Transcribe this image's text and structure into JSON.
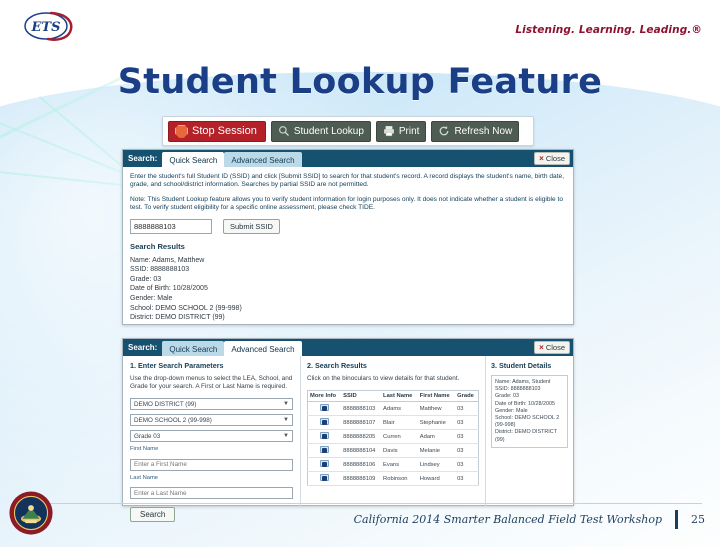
{
  "header": {
    "logo_text": "ETS",
    "tagline": "Listening. Learning. Leading.®"
  },
  "slide": {
    "title": "Student Lookup Feature"
  },
  "toolbar": {
    "stop_session": "Stop Session",
    "student_lookup": "Student Lookup",
    "print": "Print",
    "refresh_now": "Refresh Now"
  },
  "quick_panel": {
    "search_label": "Search:",
    "tab_quick": "Quick Search",
    "tab_advanced": "Advanced Search",
    "close_label": "Close",
    "close_x": "×",
    "help_paragraph": "Enter the student's full Student ID (SSID) and click [Submit SSID] to search for that student's record. A record displays the student's name, birth date, grade, and school/district information. Searches by partial SSID are not permitted.",
    "note_paragraph": "Note: This Student Lookup feature allows you to verify student information for login purposes only. It does not indicate whether a student is eligible to test. To verify student eligibility for a specific online assessment, please check TIDE.",
    "ssid_value": "8888888103",
    "submit_label": "Submit SSID",
    "results_heading": "Search Results",
    "result_lines": [
      "Name: Adams, Matthew",
      "SSID: 8888888103",
      "Grade: 03",
      "Date of Birth: 10/28/2005",
      "Gender: Male",
      "School: DEMO SCHOOL 2 (99-998)",
      "District: DEMO DISTRICT (99)"
    ]
  },
  "advanced_panel": {
    "search_label": "Search:",
    "tab_quick": "Quick Search",
    "tab_advanced": "Advanced Search",
    "close_label": "Close",
    "close_x": "×",
    "params": {
      "title": "1. Enter Search Parameters",
      "description": "Use the drop-down menus to select the LEA, School, and Grade for your search. A First or Last Name is required.",
      "district_value": "DEMO DISTRICT (99)",
      "school_value": "DEMO SCHOOL 2 (99-998)",
      "grade_value": "Grade 03",
      "first_name_label": "First Name",
      "first_name_placeholder": "Enter a First Name",
      "last_name_label": "Last Name",
      "last_name_placeholder": "Enter a Last Name",
      "search_button": "Search",
      "caret": "▼"
    },
    "results": {
      "title": "2. Search Results",
      "description": "Click on the binoculars to view details for that student.",
      "columns": [
        "More Info",
        "SSID",
        "Last Name",
        "First Name",
        "Grade"
      ],
      "rows": [
        {
          "ssid": "8888888103",
          "last_name": "Adams",
          "first_name": "Matthew",
          "grade": "03"
        },
        {
          "ssid": "8888888107",
          "last_name": "Blair",
          "first_name": "Stephanie",
          "grade": "03"
        },
        {
          "ssid": "8888888205",
          "last_name": "Curren",
          "first_name": "Adam",
          "grade": "03"
        },
        {
          "ssid": "8888888104",
          "last_name": "Davis",
          "first_name": "Melanie",
          "grade": "03"
        },
        {
          "ssid": "8888888106",
          "last_name": "Evans",
          "first_name": "Lindsey",
          "grade": "03"
        },
        {
          "ssid": "8888888109",
          "last_name": "Robinson",
          "first_name": "Howard",
          "grade": "03"
        }
      ]
    },
    "details": {
      "title": "3. Student Details",
      "lines": [
        "Name: Adams, Student",
        "SSID: 8888888103",
        "Grade: 03",
        "Date of Birth: 10/28/2005",
        "Gender: Male",
        "School: DEMO SCHOOL 2 (99-998)",
        "District: DEMO DISTRICT (99)"
      ]
    }
  },
  "footer": {
    "text": "California 2014 Smarter Balanced Field Test Workshop",
    "page_number": "25"
  },
  "colors": {
    "title_blue": "#1b3f87",
    "panel_header": "#16516f",
    "stop_red": "#b42128",
    "toolbar_green": "#4e5c53",
    "tagline_maroon": "#8c1230"
  }
}
